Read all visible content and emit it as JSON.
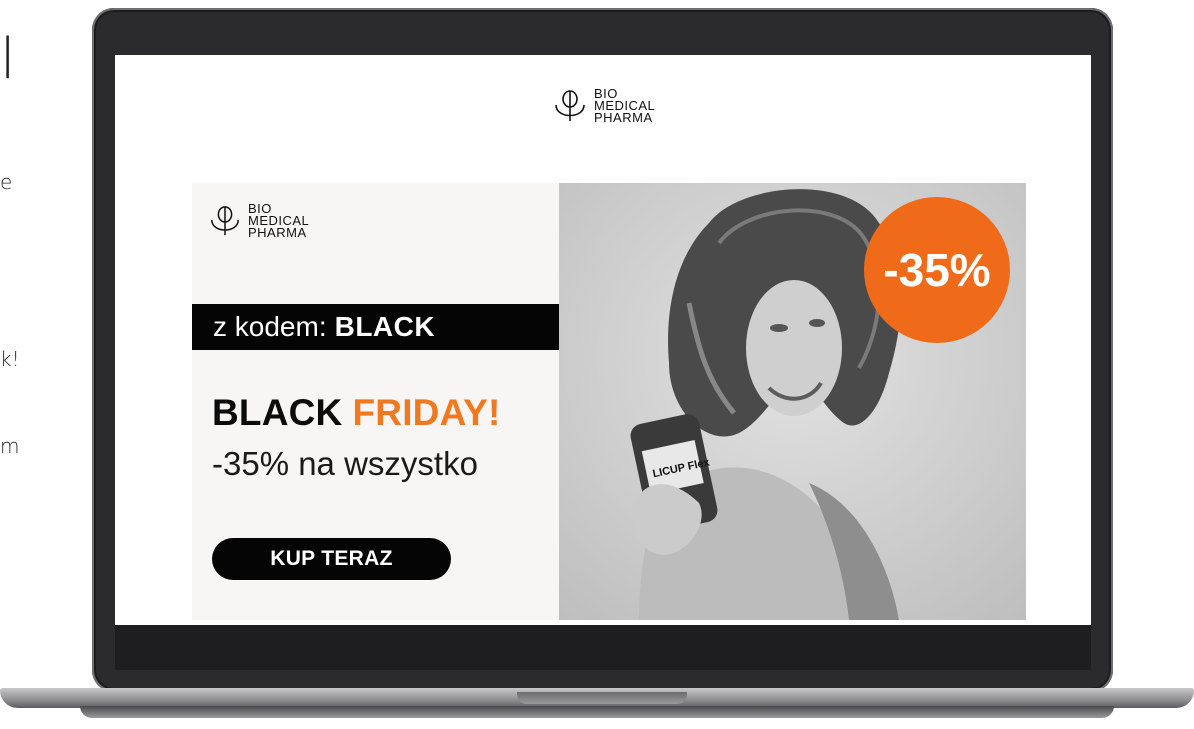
{
  "side_fragments": {
    "f1": "l",
    "f2": "e",
    "f3": "k!",
    "f4": "m"
  },
  "site": {
    "logo_lines": [
      "BIO",
      "MEDICAL",
      "PHARMA"
    ]
  },
  "banner": {
    "logo_lines": [
      "BIO",
      "MEDICAL",
      "PHARMA"
    ],
    "code_prefix": "z kodem:",
    "code_value": "BLACK",
    "headline_black": "BLACK",
    "headline_orange": "FRIDAY!",
    "subline": "-35% na wszystko",
    "cta_label": "KUP TERAZ",
    "badge_text": "-35%",
    "product_label": "LICUP Flex"
  },
  "colors": {
    "accent_orange": "#f06b19",
    "headline_orange": "#f07820",
    "black": "#050505",
    "banner_left_bg": "#f7f6f4"
  }
}
